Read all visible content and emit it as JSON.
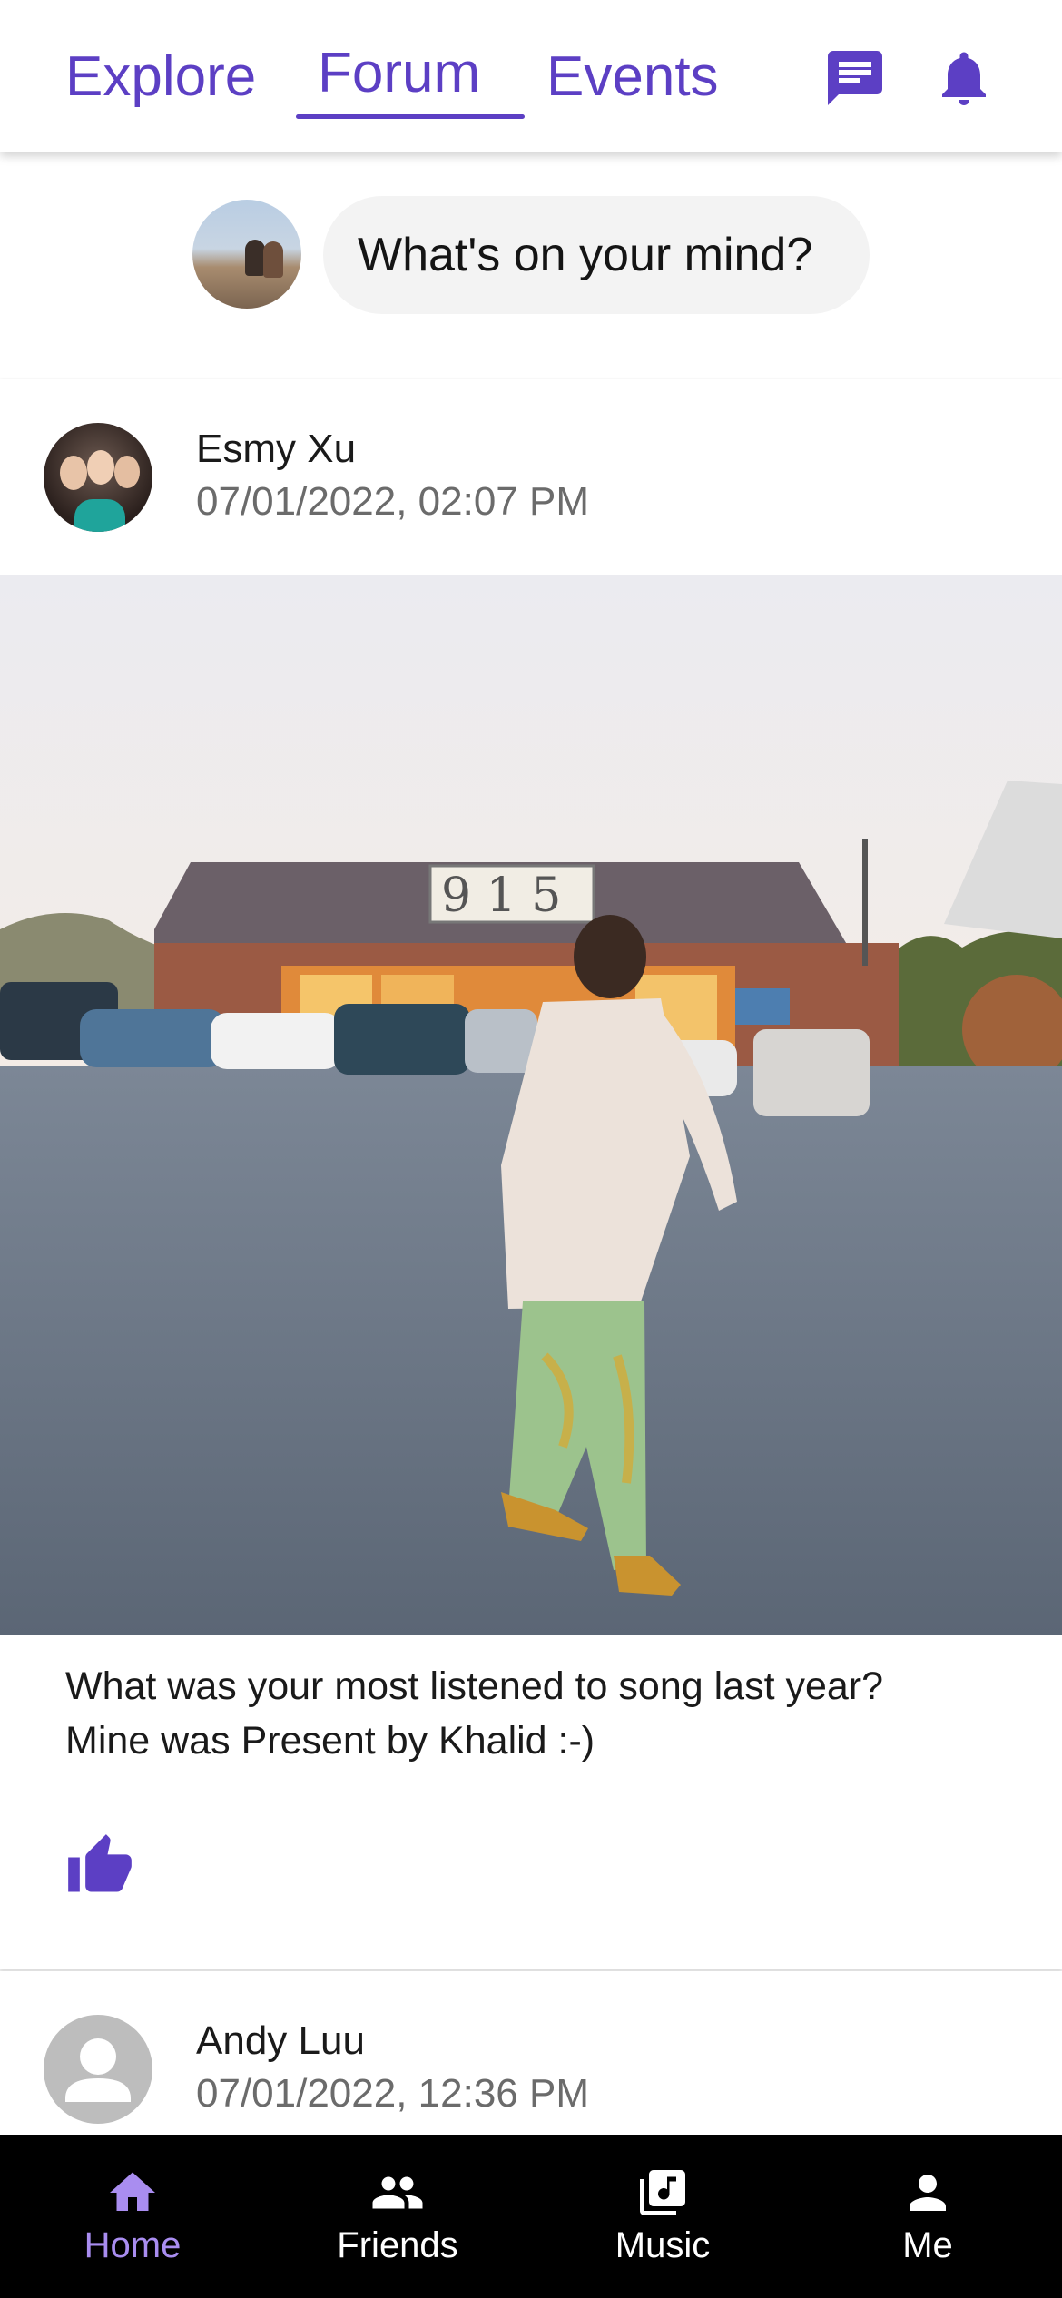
{
  "top_nav": {
    "tabs": [
      {
        "label": "Explore",
        "active": false
      },
      {
        "label": "Forum",
        "active": true
      },
      {
        "label": "Events",
        "active": false
      }
    ],
    "icons": [
      "chat-icon",
      "bell-icon"
    ],
    "accent_color": "#5c3fc4"
  },
  "composer": {
    "placeholder": "What's on your mind?"
  },
  "posts": [
    {
      "author": "Esmy Xu",
      "timestamp": "07/01/2022, 02:07 PM",
      "text_line1": "What was your most listened to song last year?",
      "text_line2": "Mine was Present by Khalid :-)",
      "has_image": true,
      "liked": true
    },
    {
      "author": "Andy Luu",
      "timestamp": "07/01/2022, 12:36 PM",
      "avatar": "default-person-icon"
    }
  ],
  "bottom_nav": {
    "items": [
      {
        "label": "Home",
        "icon": "home-icon",
        "active": true
      },
      {
        "label": "Friends",
        "icon": "people-icon",
        "active": false
      },
      {
        "label": "Music",
        "icon": "music-library-icon",
        "active": false
      },
      {
        "label": "Me",
        "icon": "person-icon",
        "active": false
      }
    ],
    "active_color": "#a98df0"
  }
}
